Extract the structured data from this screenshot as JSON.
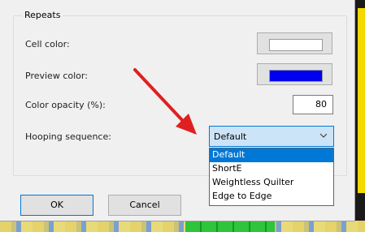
{
  "dialog": {
    "group_title": "Repeats",
    "cell_color_label": "Cell color:",
    "cell_color": "#ffffff",
    "preview_color_label": "Preview color:",
    "preview_color": "#0000f0",
    "opacity_label": "Color opacity (%):",
    "opacity_value": "80",
    "hooping_label": "Hooping sequence:",
    "hooping_value": "Default",
    "hooping_options": [
      "Default",
      "ShortE",
      "Weightless Quilter",
      "Edge to Edge"
    ],
    "selected_option_index": 0,
    "ok_label": "OK",
    "cancel_label": "Cancel"
  },
  "colors": {
    "accent": "#0078d7",
    "annotation_arrow": "#e02020"
  },
  "icons": {
    "combo_arrow": "chevron-down-icon",
    "annotation": "red-arrow-annotation"
  }
}
